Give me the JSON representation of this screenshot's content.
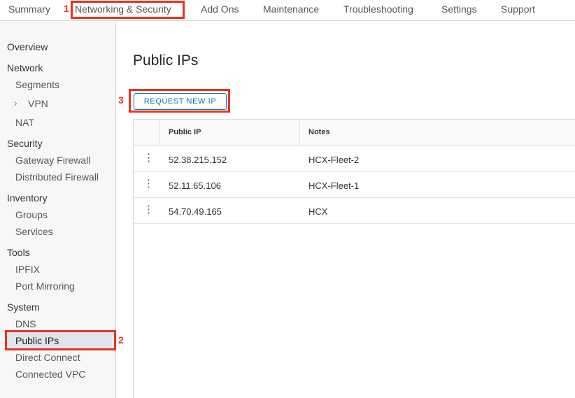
{
  "topnav": {
    "tabs": [
      "Summary",
      "Networking & Security",
      "Add Ons",
      "Maintenance",
      "Troubleshooting",
      "Settings",
      "Support"
    ]
  },
  "annotations": {
    "step1": "1",
    "step2": "2",
    "step3": "3",
    "highlight_color": "#e8331c"
  },
  "sidebar": {
    "overview": "Overview",
    "network": {
      "header": "Network",
      "items": [
        "Segments",
        "VPN",
        "NAT"
      ]
    },
    "security": {
      "header": "Security",
      "items": [
        "Gateway Firewall",
        "Distributed Firewall"
      ]
    },
    "inventory": {
      "header": "Inventory",
      "items": [
        "Groups",
        "Services"
      ]
    },
    "tools": {
      "header": "Tools",
      "items": [
        "IPFIX",
        "Port Mirroring"
      ]
    },
    "system": {
      "header": "System",
      "items": [
        "DNS",
        "Public IPs",
        "Direct Connect",
        "Connected VPC"
      ]
    },
    "active_item": "Public IPs"
  },
  "main": {
    "title": "Public IPs",
    "request_button": "REQUEST NEW IP",
    "table": {
      "columns": [
        "Public IP",
        "Notes"
      ],
      "rows": [
        {
          "ip": "52.38.215.152",
          "notes": "HCX-Fleet-2"
        },
        {
          "ip": "52.11.65.106",
          "notes": "HCX-Fleet-1"
        },
        {
          "ip": "54.70.49.165",
          "notes": "HCX"
        }
      ]
    }
  },
  "colors": {
    "accent": "#0079b8",
    "active_bg": "#dfe5ea",
    "sidebar_bg": "#f7f7f7"
  }
}
